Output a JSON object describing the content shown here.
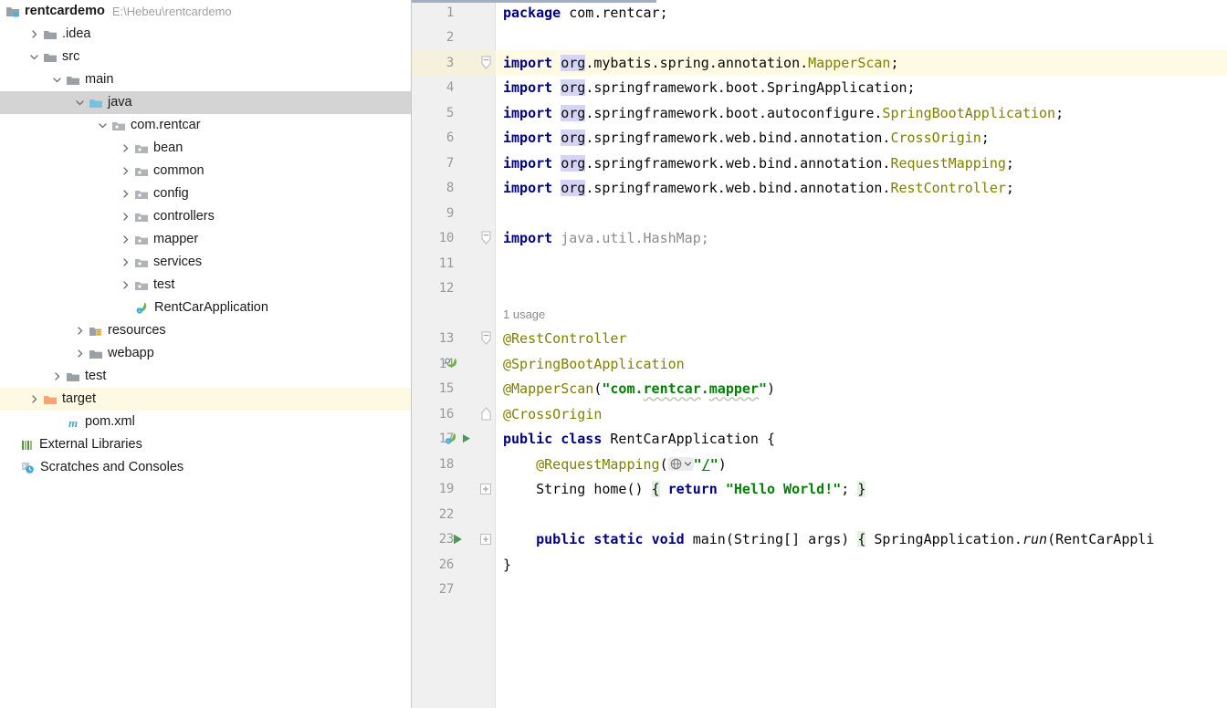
{
  "project": {
    "name": "rentcardemo",
    "path": "E:\\Hebeu\\rentcardemo",
    "icon": "module-icon",
    "tree": [
      {
        "label": ".idea",
        "indent": 1,
        "twisty": "right",
        "icon": "folder-icon",
        "state": "normal"
      },
      {
        "label": "src",
        "indent": 1,
        "twisty": "down",
        "icon": "folder-icon",
        "state": "normal"
      },
      {
        "label": "main",
        "indent": 2,
        "twisty": "down",
        "icon": "folder-icon",
        "state": "normal"
      },
      {
        "label": "java",
        "indent": 3,
        "twisty": "down",
        "icon": "source-folder-icon",
        "state": "selected"
      },
      {
        "label": "com.rentcar",
        "indent": 4,
        "twisty": "down",
        "icon": "package-icon",
        "state": "normal"
      },
      {
        "label": "bean",
        "indent": 5,
        "twisty": "right",
        "icon": "package-icon",
        "state": "normal"
      },
      {
        "label": "common",
        "indent": 5,
        "twisty": "right",
        "icon": "package-icon",
        "state": "normal"
      },
      {
        "label": "config",
        "indent": 5,
        "twisty": "right",
        "icon": "package-icon",
        "state": "normal"
      },
      {
        "label": "controllers",
        "indent": 5,
        "twisty": "right",
        "icon": "package-icon",
        "state": "normal"
      },
      {
        "label": "mapper",
        "indent": 5,
        "twisty": "right",
        "icon": "package-icon",
        "state": "normal"
      },
      {
        "label": "services",
        "indent": 5,
        "twisty": "right",
        "icon": "package-icon",
        "state": "normal"
      },
      {
        "label": "test",
        "indent": 5,
        "twisty": "right",
        "icon": "package-icon",
        "state": "normal"
      },
      {
        "label": "RentCarApplication",
        "indent": 5,
        "twisty": "none",
        "icon": "spring-class-icon",
        "state": "normal"
      },
      {
        "label": "resources",
        "indent": 3,
        "twisty": "right",
        "icon": "resources-folder-icon",
        "state": "normal"
      },
      {
        "label": "webapp",
        "indent": 3,
        "twisty": "right",
        "icon": "folder-icon",
        "state": "normal"
      },
      {
        "label": "test",
        "indent": 2,
        "twisty": "right",
        "icon": "folder-icon",
        "state": "normal"
      },
      {
        "label": "target",
        "indent": 1,
        "twisty": "right",
        "icon": "excluded-folder-icon",
        "state": "highlight"
      },
      {
        "label": "pom.xml",
        "indent": 2,
        "twisty": "none",
        "icon": "maven-icon",
        "state": "normal"
      },
      {
        "label": "External Libraries",
        "indent": 0,
        "twisty": "none",
        "icon": "libraries-icon",
        "state": "normal"
      },
      {
        "label": "Scratches and Consoles",
        "indent": 0,
        "twisty": "none",
        "icon": "scratches-icon",
        "state": "normal"
      }
    ]
  },
  "editor": {
    "file": "RentCarApplication.java",
    "caret_line": 3,
    "lines": [
      {
        "num": "1",
        "gutter_icon": "",
        "fold": "",
        "caret": false,
        "tokens": [
          {
            "t": "package",
            "c": "kw"
          },
          {
            "t": " com.rentcar;",
            "c": "plain"
          }
        ]
      },
      {
        "num": "2",
        "gutter_icon": "",
        "fold": "",
        "caret": false,
        "tokens": []
      },
      {
        "num": "3",
        "gutter_icon": "",
        "fold": "collapse",
        "caret": true,
        "tokens": [
          {
            "t": "import",
            "c": "kw"
          },
          {
            "t": " ",
            "c": "plain"
          },
          {
            "t": "org",
            "c": "hl-occ"
          },
          {
            "t": ".mybatis.spring.annotation.",
            "c": "plain"
          },
          {
            "t": "MapperScan",
            "c": "cls"
          },
          {
            "t": ";",
            "c": "plain"
          }
        ]
      },
      {
        "num": "4",
        "gutter_icon": "",
        "fold": "",
        "caret": false,
        "tokens": [
          {
            "t": "import",
            "c": "kw"
          },
          {
            "t": " ",
            "c": "plain"
          },
          {
            "t": "org",
            "c": "hl-occ"
          },
          {
            "t": ".springframework.boot.",
            "c": "plain"
          },
          {
            "t": "SpringApplication",
            "c": "plain"
          },
          {
            "t": ";",
            "c": "plain"
          }
        ]
      },
      {
        "num": "5",
        "gutter_icon": "",
        "fold": "",
        "caret": false,
        "tokens": [
          {
            "t": "import",
            "c": "kw"
          },
          {
            "t": " ",
            "c": "plain"
          },
          {
            "t": "org",
            "c": "hl-occ"
          },
          {
            "t": ".springframework.boot.autoconfigure.",
            "c": "plain"
          },
          {
            "t": "SpringBootApplication",
            "c": "cls"
          },
          {
            "t": ";",
            "c": "plain"
          }
        ]
      },
      {
        "num": "6",
        "gutter_icon": "",
        "fold": "",
        "caret": false,
        "tokens": [
          {
            "t": "import",
            "c": "kw"
          },
          {
            "t": " ",
            "c": "plain"
          },
          {
            "t": "org",
            "c": "hl-occ"
          },
          {
            "t": ".springframework.web.bind.annotation.",
            "c": "plain"
          },
          {
            "t": "CrossOrigin",
            "c": "cls"
          },
          {
            "t": ";",
            "c": "plain"
          }
        ]
      },
      {
        "num": "7",
        "gutter_icon": "",
        "fold": "",
        "caret": false,
        "tokens": [
          {
            "t": "import",
            "c": "kw"
          },
          {
            "t": " ",
            "c": "plain"
          },
          {
            "t": "org",
            "c": "hl-occ"
          },
          {
            "t": ".springframework.web.bind.annotation.",
            "c": "plain"
          },
          {
            "t": "RequestMapping",
            "c": "cls"
          },
          {
            "t": ";",
            "c": "plain"
          }
        ]
      },
      {
        "num": "8",
        "gutter_icon": "",
        "fold": "",
        "caret": false,
        "tokens": [
          {
            "t": "import",
            "c": "kw"
          },
          {
            "t": " ",
            "c": "plain"
          },
          {
            "t": "org",
            "c": "hl-occ"
          },
          {
            "t": ".springframework.web.bind.annotation.",
            "c": "plain"
          },
          {
            "t": "RestController",
            "c": "cls"
          },
          {
            "t": ";",
            "c": "plain"
          }
        ]
      },
      {
        "num": "9",
        "gutter_icon": "",
        "fold": "",
        "caret": false,
        "tokens": []
      },
      {
        "num": "10",
        "gutter_icon": "",
        "fold": "collapse",
        "caret": false,
        "tokens": [
          {
            "t": "import",
            "c": "kw"
          },
          {
            "t": " java.util.HashMap;",
            "c": "gray"
          }
        ]
      },
      {
        "num": "11",
        "gutter_icon": "",
        "fold": "",
        "caret": false,
        "tokens": []
      },
      {
        "num": "12",
        "gutter_icon": "",
        "fold": "",
        "caret": false,
        "tokens": []
      },
      {
        "num": "",
        "gutter_icon": "",
        "fold": "",
        "caret": false,
        "inlay": "1 usage",
        "tokens": []
      },
      {
        "num": "13",
        "gutter_icon": "",
        "fold": "collapse",
        "caret": false,
        "tokens": [
          {
            "t": "@RestController",
            "c": "anno"
          }
        ]
      },
      {
        "num": "14",
        "gutter_icon": "spring-bean-search-icon",
        "fold": "",
        "caret": false,
        "tokens": [
          {
            "t": "@SpringBootApplication",
            "c": "anno"
          }
        ]
      },
      {
        "num": "15",
        "gutter_icon": "",
        "fold": "",
        "caret": false,
        "tokens": [
          {
            "t": "@MapperScan",
            "c": "anno"
          },
          {
            "t": "(",
            "c": "plain"
          },
          {
            "t": "\"com.",
            "c": "str"
          },
          {
            "t": "rentcar",
            "c": "str typo"
          },
          {
            "t": ".",
            "c": "str"
          },
          {
            "t": "mapper",
            "c": "str typo"
          },
          {
            "t": "\"",
            "c": "str"
          },
          {
            "t": ")",
            "c": "plain"
          }
        ]
      },
      {
        "num": "16",
        "gutter_icon": "",
        "fold": "collapse-end",
        "caret": false,
        "tokens": [
          {
            "t": "@CrossOrigin",
            "c": "anno"
          }
        ]
      },
      {
        "num": "17",
        "gutter_icon": "spring-run-icons",
        "fold": "",
        "caret": false,
        "tokens": [
          {
            "t": "public",
            "c": "kw"
          },
          {
            "t": " ",
            "c": "plain"
          },
          {
            "t": "class",
            "c": "kw"
          },
          {
            "t": " RentCarApplication {",
            "c": "plain"
          }
        ]
      },
      {
        "num": "18",
        "gutter_icon": "",
        "fold": "",
        "caret": false,
        "tokens": [
          {
            "t": "    @RequestMapping",
            "c": "anno"
          },
          {
            "t": "(",
            "c": "plain"
          },
          {
            "t": "GLOBE",
            "c": "globe"
          },
          {
            "t": "\"",
            "c": "str"
          },
          {
            "t": "/",
            "c": "str urlu"
          },
          {
            "t": "\"",
            "c": "str"
          },
          {
            "t": ")",
            "c": "plain"
          }
        ]
      },
      {
        "num": "19",
        "gutter_icon": "",
        "fold": "expand",
        "caret": false,
        "tokens": [
          {
            "t": "    String home() ",
            "c": "plain"
          },
          {
            "t": "{",
            "c": "brace-hl"
          },
          {
            "t": " ",
            "c": "plain"
          },
          {
            "t": "return",
            "c": "kw"
          },
          {
            "t": " ",
            "c": "plain"
          },
          {
            "t": "\"Hello World!\"",
            "c": "str"
          },
          {
            "t": "; ",
            "c": "plain"
          },
          {
            "t": "}",
            "c": "brace-hl"
          }
        ]
      },
      {
        "num": "22",
        "gutter_icon": "",
        "fold": "",
        "caret": false,
        "tokens": []
      },
      {
        "num": "23",
        "gutter_icon": "run-icon",
        "fold": "expand",
        "caret": false,
        "tokens": [
          {
            "t": "    ",
            "c": "plain"
          },
          {
            "t": "public",
            "c": "kw"
          },
          {
            "t": " ",
            "c": "plain"
          },
          {
            "t": "static",
            "c": "kw"
          },
          {
            "t": " ",
            "c": "plain"
          },
          {
            "t": "void",
            "c": "kw"
          },
          {
            "t": " main(String[] args) ",
            "c": "plain"
          },
          {
            "t": "{",
            "c": "brace-hl"
          },
          {
            "t": " SpringApplication.",
            "c": "plain"
          },
          {
            "t": "run",
            "c": "ital"
          },
          {
            "t": "(RentCarAppli",
            "c": "plain"
          }
        ]
      },
      {
        "num": "26",
        "gutter_icon": "",
        "fold": "",
        "caret": false,
        "tokens": [
          {
            "t": "}",
            "c": "plain"
          }
        ]
      },
      {
        "num": "27",
        "gutter_icon": "",
        "fold": "",
        "caret": false,
        "tokens": []
      }
    ]
  },
  "colors": {
    "caret_line_bg": "#fffae3",
    "gutter_bg": "#f0f0f0",
    "selection_bg": "#d4d4d4",
    "highlight_bg": "#fdf9e2",
    "keyword": "#000080",
    "string": "#008000",
    "annotation": "#808000",
    "occurrence_bg": "#d4d4f7",
    "excluded_folder": "#f5a673",
    "source_folder": "#72c2e0"
  }
}
